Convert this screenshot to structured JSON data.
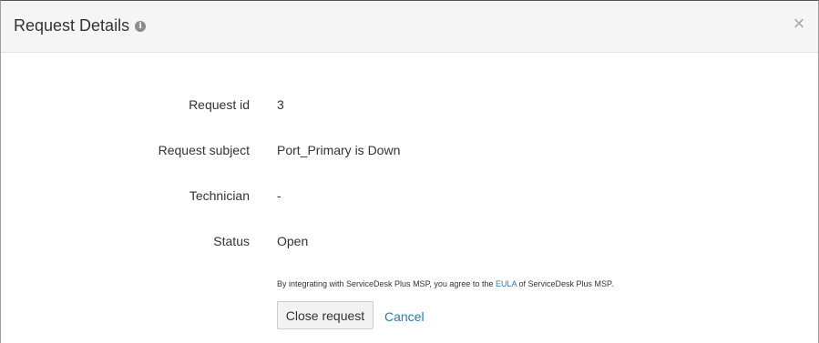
{
  "dialog": {
    "title": "Request Details",
    "info_icon": "info-icon",
    "info_glyph": "i",
    "close_icon": "close-icon",
    "close_glyph": "×"
  },
  "details": [
    {
      "label": "Request id",
      "value": "3"
    },
    {
      "label": "Request subject",
      "value": "Port_Primary is Down"
    },
    {
      "label": "Technician",
      "value": "-"
    },
    {
      "label": "Status",
      "value": "Open"
    }
  ],
  "disclaimer": {
    "before": "By integrating with ServiceDesk Plus MSP, you agree to the ",
    "link": "EULA",
    "after": " of ServiceDesk Plus MSP."
  },
  "actions": {
    "close_request_label": "Close request",
    "cancel_label": "Cancel"
  },
  "colors": {
    "link": "#2a7ab8",
    "header_bg": "#f5f5f5",
    "text": "#333333"
  }
}
